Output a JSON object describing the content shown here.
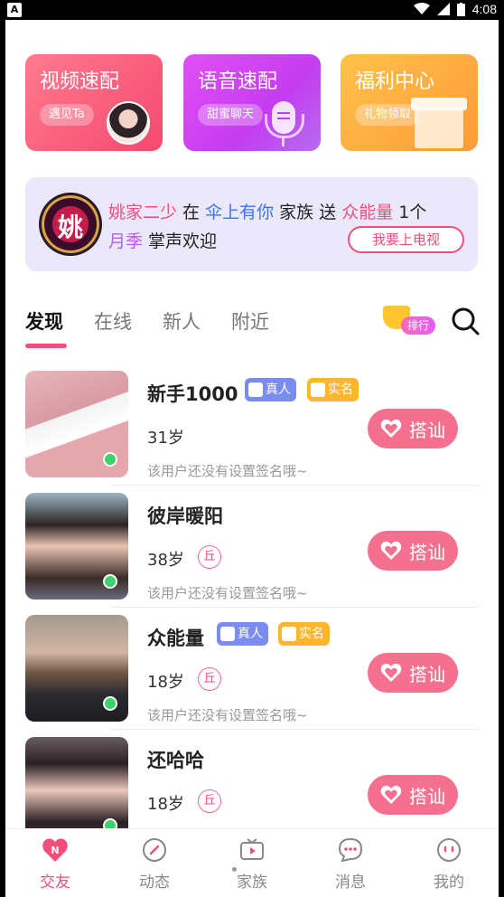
{
  "status_bar": {
    "time": "4:08",
    "app_badge": "A"
  },
  "quick_cards": [
    {
      "title": "视频速配",
      "pill": "遇见Ta"
    },
    {
      "title": "语音速配",
      "pill": "甜蜜聊天"
    },
    {
      "title": "福利中心",
      "pill": "礼物领取"
    }
  ],
  "banner": {
    "logo_char": "姚",
    "line1": [
      {
        "text": "姚家二少",
        "style": "pink"
      },
      {
        "text": " 在 ",
        "style": ""
      },
      {
        "text": "伞上有你",
        "style": "blue"
      },
      {
        "text": " 家族 送 ",
        "style": ""
      },
      {
        "text": "众能量",
        "style": "pink"
      },
      {
        "text": " 1个",
        "style": ""
      }
    ],
    "line2": [
      {
        "text": "月季",
        "style": "purple"
      },
      {
        "text": " 掌声欢迎",
        "style": ""
      }
    ],
    "button": "我要上电视"
  },
  "tabs": [
    "发现",
    "在线",
    "新人",
    "附近"
  ],
  "rank_badge": "排行",
  "users": [
    {
      "name": "新手1000",
      "tags": [
        "真人",
        "实名"
      ],
      "age": "31岁",
      "zodiac": "",
      "signature": "该用户还没有设置签名哦~",
      "action": "搭讪"
    },
    {
      "name": "彼岸暖阳",
      "tags": [],
      "age": "38岁",
      "zodiac": "丘",
      "signature": "该用户还没有设置签名哦~",
      "action": "搭讪"
    },
    {
      "name": "众能量",
      "tags": [
        "真人",
        "实名"
      ],
      "age": "18岁",
      "zodiac": "丘",
      "signature": "该用户还没有设置签名哦~",
      "action": "搭讪"
    },
    {
      "name": "还哈哈",
      "tags": [],
      "age": "18岁",
      "zodiac": "丘",
      "signature": "",
      "action": "搭讪"
    }
  ],
  "bottom_nav": [
    "交友",
    "动态",
    "家族",
    "消息",
    "我的"
  ],
  "colors": {
    "accent": "#f04f79",
    "button": "#f5708f",
    "online": "#3dd36b"
  }
}
